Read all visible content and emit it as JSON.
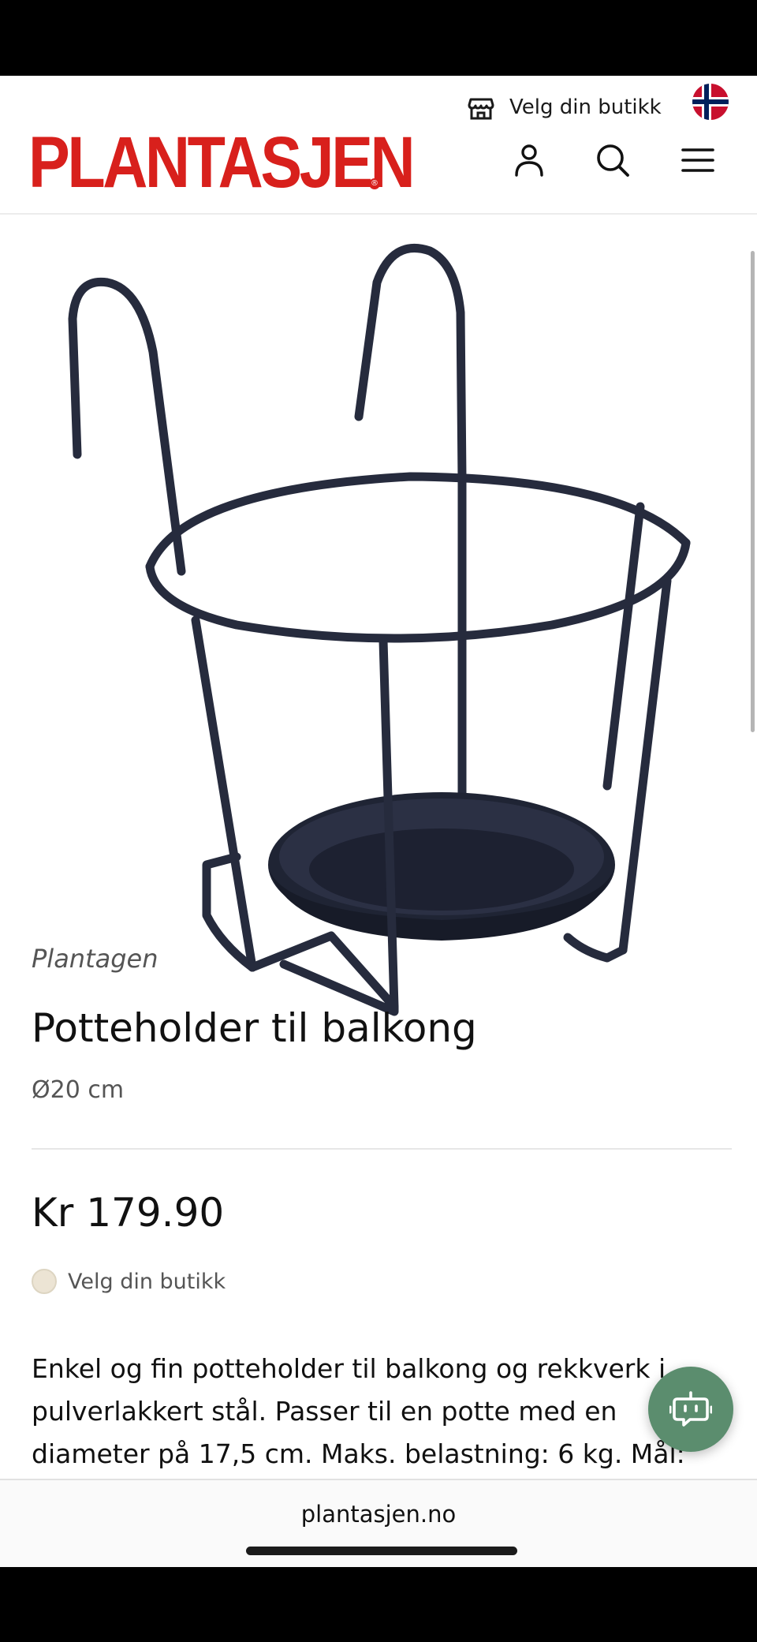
{
  "header": {
    "store_label": "Velg din butikk",
    "logo_text": "PLANTASJEN",
    "icons": [
      "store-icon",
      "norway-flag-icon",
      "account-icon",
      "search-icon",
      "menu-icon"
    ]
  },
  "product": {
    "brand": "Plantagen",
    "title": "Potteholder til balkong",
    "variant": "Ø20 cm",
    "price": "Kr 179.90",
    "availability_label": "Velg din butikk",
    "description": "Enkel og fin potteholder til balkong og rekkverk i pulverlakkert stål. Passer til en potte med en diameter på 17,5 cm. Maks. belastning: 6 kg. Mål:"
  },
  "browser": {
    "url": "plantasjen.no"
  },
  "colors": {
    "brand_red": "#d8201c",
    "chat_green": "#5b8d6e",
    "product_navy": "#262b3d"
  }
}
